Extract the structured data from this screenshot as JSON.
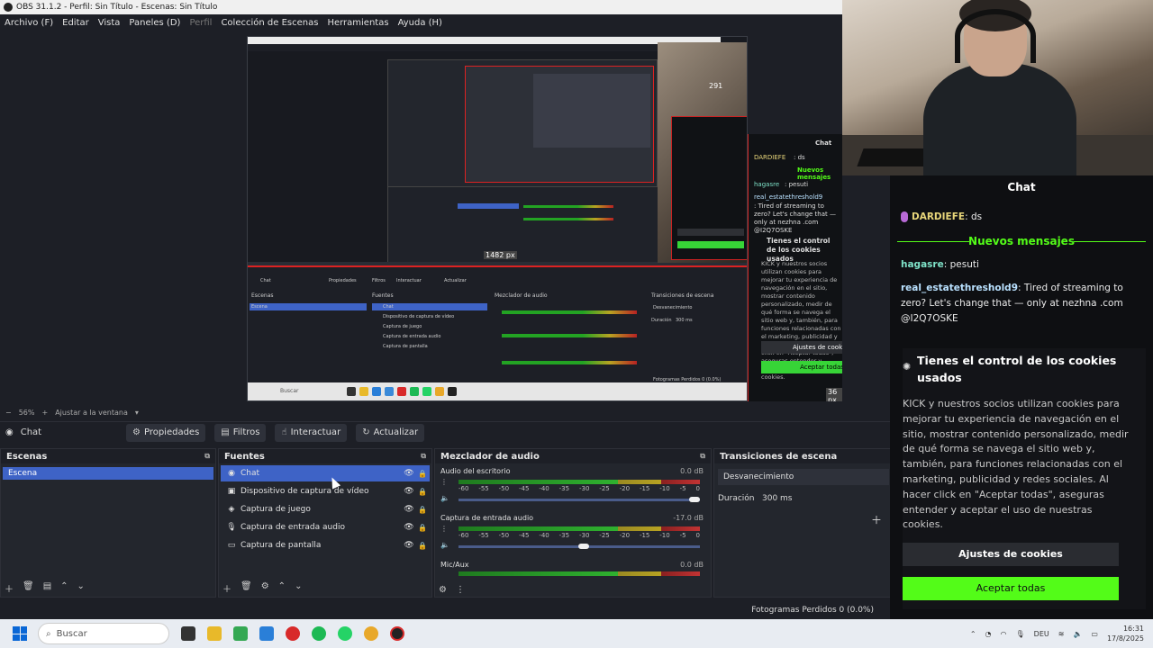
{
  "window": {
    "title": "OBS 31.1.2 - Perfil: Sin Título - Escenas: Sin Título"
  },
  "menu": [
    "Archivo (F)",
    "Editar",
    "Vista",
    "Paneles (D)",
    "Perfil",
    "Colección de Escenas",
    "Herramientas",
    "Ayuda (H)"
  ],
  "preview": {
    "measure_1": "1482 px",
    "measure_2": "36 px",
    "measure_3": "291",
    "nested_chat": {
      "title": "Chat",
      "line1_user": "DARDIEFE",
      "line1_msg": ": ds",
      "new_msgs": "Nuevos mensajes",
      "line2_user": "hagasre",
      "line2_msg": ": pesuti",
      "line3_user": "real_estatethreshold9",
      "line3_msg": ": Tired of streaming to zero? Let's change that — only at nezhna .com @I2Q7OSKE",
      "cookie_title": "Tienes el control de los cookies usados",
      "cookie_text": "KICK y nuestros socios utilizan cookies para mejorar tu experiencia de navegación en el sitio, mostrar contenido personalizado, medir de qué forma se navega el sitio web y, también, para funciones relacionadas con el marketing, publicidad y redes sociales. Al hacer click en \"Aceptar todas\", aseguras entender y aceptar el uso de nuestras cookies.",
      "settings_btn": "Ajustes de cookies",
      "accept_btn": "Aceptar todas"
    },
    "nested_obs": {
      "tab_chat": "Chat",
      "btn_props": "Propiedades",
      "btn_filters": "Filtros",
      "btn_interact": "Interactuar",
      "btn_refresh": "Actualizar",
      "hdr_scenes": "Escenas",
      "hdr_sources": "Fuentes",
      "hdr_mixer": "Mezclador de audio",
      "hdr_trans": "Transiciones de escena",
      "scene": "Escena",
      "src1": "Chat",
      "src2": "Dispositivo de captura de vídeo",
      "src3": "Captura de juego",
      "src4": "Captura de entrada audio",
      "src5": "Captura de pantalla",
      "trans_sel": "Desvanecimiento",
      "trans_dur_label": "Duración",
      "trans_dur": "300 ms",
      "status": "Fotogramas Perdidos 0 (0.0%)",
      "taskbar_search": "Buscar"
    }
  },
  "zoombar": {
    "zoom": "56%",
    "fit": "Ajustar a la ventana"
  },
  "source_toolbar": {
    "current_source": "Chat",
    "properties": "Propiedades",
    "filters": "Filtros",
    "interact": "Interactuar",
    "refresh": "Actualizar"
  },
  "scenes": {
    "title": "Escenas",
    "items": [
      "Escena"
    ]
  },
  "sources": {
    "title": "Fuentes",
    "items": [
      {
        "label": "Chat",
        "icon": "globe-icon",
        "selected": true
      },
      {
        "label": "Dispositivo de captura de vídeo",
        "icon": "camera-icon",
        "selected": false
      },
      {
        "label": "Captura de juego",
        "icon": "gamepad-icon",
        "selected": false
      },
      {
        "label": "Captura de entrada audio",
        "icon": "microphone-icon",
        "selected": false
      },
      {
        "label": "Captura de pantalla",
        "icon": "monitor-icon",
        "selected": false
      }
    ]
  },
  "mixer": {
    "title": "Mezclador de audio",
    "scale": [
      "-60",
      "-55",
      "-50",
      "-45",
      "-40",
      "-35",
      "-30",
      "-25",
      "-20",
      "-15",
      "-10",
      "-5",
      "0"
    ],
    "channels": [
      {
        "name": "Audio del escritorio",
        "db": "0.0 dB",
        "volume": 1.0
      },
      {
        "name": "Captura de entrada audio",
        "db": "-17.0 dB",
        "volume": 0.52
      },
      {
        "name": "Mic/Aux",
        "db": "0.0 dB",
        "volume": 1.0
      }
    ]
  },
  "transitions": {
    "title": "Transiciones de escena",
    "selected": "Desvanecimiento",
    "duration_label": "Duración",
    "duration": "300 ms"
  },
  "status": {
    "dropped": "Fotogramas Perdidos 0 (0.0%)"
  },
  "kick_chat": {
    "title": "Chat",
    "msg1_user": "DARDIEFE",
    "msg1_text": ": ds",
    "new_messages": "Nuevos mensajes",
    "msg2_user": "hagasre",
    "msg2_text": ": pesuti",
    "msg3_user": "real_estatethreshold9",
    "msg3_text": ": Tired of streaming to zero? Let's change that — only at nezhna .com @I2Q7OSKE",
    "cookie_title": "Tienes el control de los cookies usados",
    "cookie_text": "KICK y nuestros socios utilizan cookies para mejorar tu experiencia de navegación en el sitio, mostrar contenido personalizado, medir de qué forma se navega el sitio web y, también, para funciones relacionadas con el marketing, publicidad y redes sociales. Al hacer click en \"Aceptar todas\", aseguras entender y aceptar el uso de nuestras cookies.",
    "cookie_settings": "Ajustes de cookies",
    "cookie_accept": "Aceptar todas",
    "colors": {
      "green": "#53fc18",
      "user_yellow": "#e8d67a",
      "user_teal": "#7fe3c9",
      "user_blue": "#b9e1ff"
    }
  },
  "taskbar": {
    "search_placeholder": "Buscar",
    "lang": "DEU",
    "time": "16:31",
    "date": "17/8/2025"
  }
}
